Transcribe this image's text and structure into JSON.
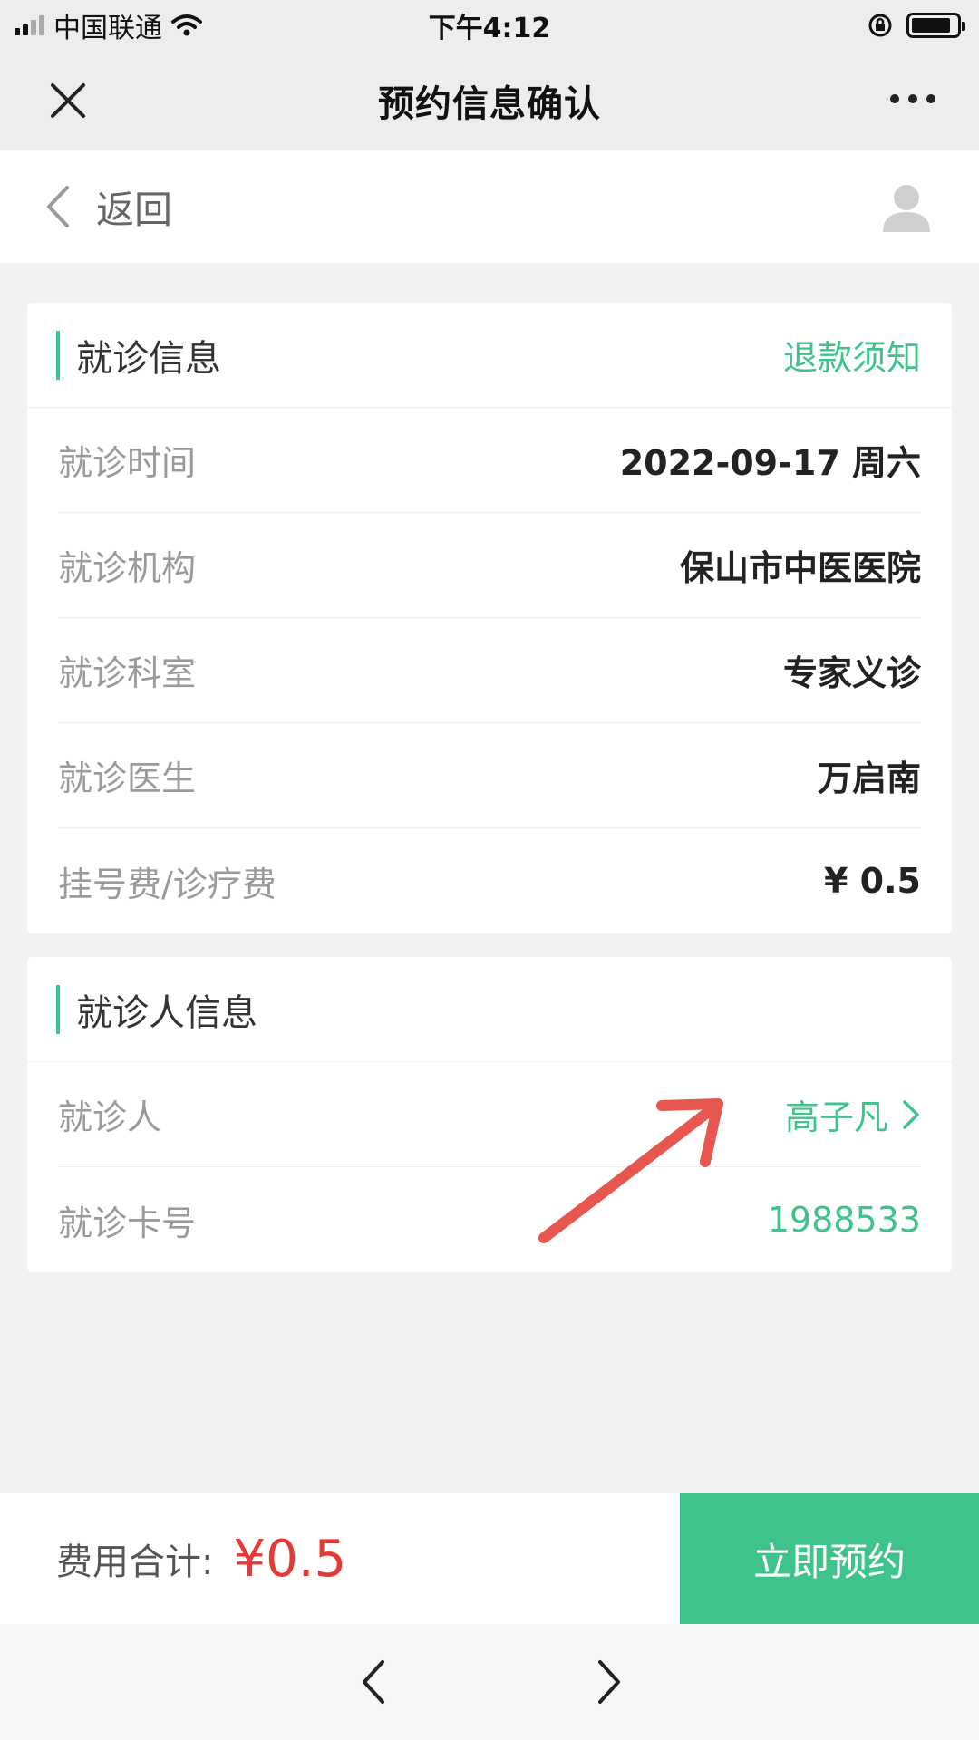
{
  "status_bar": {
    "carrier": "中国联通",
    "time": "下午4:12"
  },
  "title_bar": {
    "title": "预约信息确认"
  },
  "back_bar": {
    "back_label": "返回"
  },
  "visit_info": {
    "title": "就诊信息",
    "refund_link": "退款须知",
    "rows": [
      {
        "label": "就诊时间",
        "value": "2022-09-17 周六"
      },
      {
        "label": "就诊机构",
        "value": "保山市中医医院"
      },
      {
        "label": "就诊科室",
        "value": "专家义诊"
      },
      {
        "label": "就诊医生",
        "value": "万启南"
      },
      {
        "label": "挂号费/诊疗费",
        "value": "¥ 0.5"
      }
    ]
  },
  "patient_info": {
    "title": "就诊人信息",
    "patient_label": "就诊人",
    "patient_name": "高子凡",
    "card_label": "就诊卡号",
    "card_number": "1988533"
  },
  "bottom_bar": {
    "total_label": "费用合计:",
    "total_value": "¥0.5",
    "book_button": "立即预约"
  },
  "colors": {
    "accent": "#3ec48a",
    "price": "#e53935",
    "annotation_arrow": "#e8574f"
  }
}
